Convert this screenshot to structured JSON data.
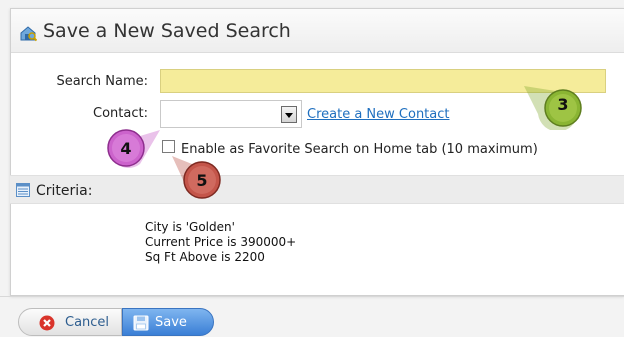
{
  "dialog": {
    "title": "Save a New Saved Search",
    "title_icon": "house-search-icon"
  },
  "form": {
    "search_name_label": "Search Name:",
    "search_name_value": "",
    "contact_label": "Contact:",
    "contact_value": "",
    "create_contact_link": "Create a New Contact",
    "favorite_checked": false,
    "favorite_label": "Enable as Favorite Search on Home tab (10 maximum)"
  },
  "criteria": {
    "label": "Criteria:",
    "icon": "list-table-icon",
    "lines": [
      "City is 'Golden'",
      "Current Price is 390000+",
      "Sq Ft Above is 2200"
    ]
  },
  "buttons": {
    "cancel_label": "Cancel",
    "save_label": "Save"
  },
  "callouts": [
    {
      "label": "3",
      "color": "#7fa52a"
    },
    {
      "label": "4",
      "color": "#c24fc2"
    },
    {
      "label": "5",
      "color": "#b8473d"
    }
  ],
  "colors": {
    "search_field_bg": "#f5ec9a",
    "link": "#1f6fbf",
    "save_button": "#3a7fd6"
  }
}
